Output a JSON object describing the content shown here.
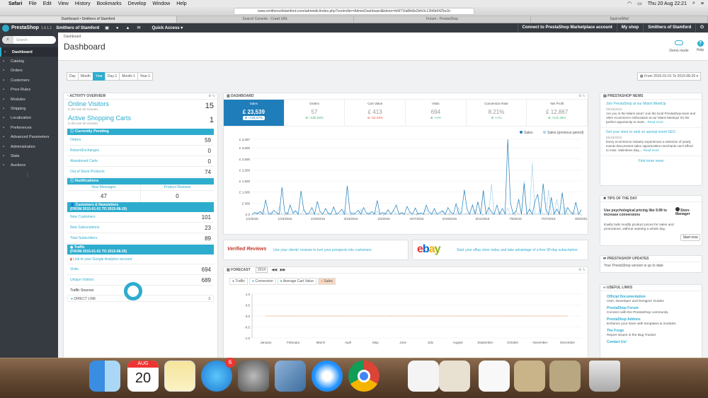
{
  "menubar": {
    "items": [
      "Safari",
      "File",
      "Edit",
      "View",
      "History",
      "Bookmarks",
      "Develop",
      "Window",
      "Help"
    ],
    "datetime": "Thu 20 Aug  22:21"
  },
  "browser": {
    "url": "www.smithersofstamford.com/admindic/index.php?controller=AdminDashboard&token=fe5f71fa8fe8e2bfc0c12b6b6425e1b",
    "tabs": [
      "Dashboard • Smithers of Stamford",
      "Search Console - Crawl URL",
      "Forum - PrestaShop",
      "SquirrelMail"
    ]
  },
  "header": {
    "brand": "PrestaShop",
    "version": "1.6.1.1",
    "shop_name": "Smithers of Stamford",
    "quick_access": "Quick Access ▾",
    "marketplace": "Connect to PrestaShop Marketplace account",
    "my_shop": "My shop",
    "employee": "Smithers of Stamford"
  },
  "sidebar": {
    "search_placeholder": "Search",
    "items": [
      {
        "label": "Dashboard",
        "icon": "dashboard-icon"
      },
      {
        "label": "Catalog",
        "icon": "catalog-icon"
      },
      {
        "label": "Orders",
        "icon": "orders-icon"
      },
      {
        "label": "Customers",
        "icon": "customers-icon"
      },
      {
        "label": "Price Rules",
        "icon": "price-rules-icon"
      },
      {
        "label": "Modules",
        "icon": "modules-icon"
      },
      {
        "label": "Shipping",
        "icon": "shipping-icon"
      },
      {
        "label": "Localization",
        "icon": "localization-icon"
      },
      {
        "label": "Preferences",
        "icon": "preferences-icon"
      },
      {
        "label": "Advanced Parameters",
        "icon": "advanced-parameters-icon"
      },
      {
        "label": "Administration",
        "icon": "administration-icon"
      },
      {
        "label": "Stats",
        "icon": "stats-icon"
      },
      {
        "label": "Auctions",
        "icon": "auctions-icon"
      }
    ]
  },
  "toolbar": {
    "breadcrumb": "Dashboard",
    "title": "Dashboard",
    "demo_mode": "Demo mode",
    "help": "Help"
  },
  "period": {
    "buttons": [
      "Day",
      "Month",
      "Year",
      "Day-1",
      "Month-1",
      "Year-1"
    ],
    "active": "Year",
    "range": "From 2015-01-01 To 2015-08-20 ▾"
  },
  "activity": {
    "title": "Activity overview",
    "online_visitors": {
      "label": "Online Visitors",
      "sub": "in the last 30 minutes",
      "value": "15"
    },
    "active_carts": {
      "label": "Active Shopping Carts",
      "sub": "in the last 30 minutes",
      "value": "1"
    },
    "pending_title": "Currently Pending",
    "pending": [
      {
        "label": "Orders",
        "value": "59"
      },
      {
        "label": "Return/Exchanges",
        "value": "0"
      },
      {
        "label": "Abandoned Carts",
        "value": "0"
      },
      {
        "label": "Out of Stock Products",
        "value": "74"
      }
    ],
    "notifications_title": "Notifications",
    "notifications": [
      {
        "label": "New Messages",
        "value": "47"
      },
      {
        "label": "Product Reviews",
        "value": "0"
      }
    ],
    "customers_title": "Customers & Newsletters",
    "customers_range": "(FROM 2015-01-01 TO 2015-08-20)",
    "customers": [
      {
        "label": "New Customers",
        "value": "101"
      },
      {
        "label": "New Subscriptions",
        "value": "23"
      },
      {
        "label": "Total Subscribers",
        "value": "89"
      }
    ],
    "traffic_title": "Traffic",
    "traffic_range": "(FROM 2015-01-01 TO 2015-08-20)",
    "ga_link": "Link to your Google Analytics account",
    "traffic": [
      {
        "label": "Visits",
        "value": "694"
      },
      {
        "label": "Unique Visitors",
        "value": "689"
      }
    ],
    "traffic_sources_label": "Traffic Sources",
    "source": {
      "label": "DIRECT LINK",
      "value": "3"
    }
  },
  "dashboard": {
    "title": "Dashboard",
    "kpis": [
      {
        "label": "Sales",
        "value": "£ 23,539",
        "delta": "+126.57%",
        "trend": "up"
      },
      {
        "label": "Orders",
        "value": "57",
        "delta": "+235.29%",
        "trend": "up"
      },
      {
        "label": "Cart Value",
        "value": "£ 413",
        "delta": "-32.43%",
        "trend": "down"
      },
      {
        "label": "Visits",
        "value": "694",
        "delta": "+∞%",
        "trend": "up"
      },
      {
        "label": "Conversion Rate",
        "value": "8.21%",
        "delta": "+∞%",
        "trend": "up"
      },
      {
        "label": "Net Profit",
        "value": "£ 12,867",
        "delta": "+121.25%",
        "trend": "up"
      }
    ]
  },
  "chart_data": [
    {
      "type": "line",
      "title": "",
      "legend": [
        "Sales",
        "Sales (previous period)"
      ],
      "legend_position": "top-right",
      "ylabel": "",
      "ylim": [
        0,
        3387
      ],
      "y_ticks": [
        "£ 3,387",
        "£ 3,000",
        "£ 2,500",
        "£ 2,000",
        "£ 1,500",
        "£ 1,000",
        "£ 500",
        "£ 0"
      ],
      "y_tick_values": [
        3387,
        3000,
        2500,
        2000,
        1500,
        1000,
        500,
        0
      ],
      "x_ticks": [
        "1/1/2015",
        "1/23/2015",
        "2/18/2015",
        "3/10/2015",
        "4/2/2015",
        "4/27/2015",
        "5/19/2015",
        "6/11/2015",
        "7/5/2015",
        "7/27/2015",
        "8/20/201"
      ],
      "series": [
        {
          "name": "Sales",
          "color": "#1f7dba",
          "values": [
            0,
            80,
            30,
            120,
            0,
            650,
            40,
            0,
            180,
            60,
            0,
            1220,
            90,
            0,
            420,
            50,
            150,
            0,
            1050,
            200,
            0,
            60,
            300,
            0,
            580,
            120,
            0,
            260,
            40,
            0,
            330,
            0,
            80,
            220,
            0,
            1280,
            90,
            0,
            40,
            180,
            0,
            300,
            60,
            0,
            120,
            0,
            620,
            0,
            80,
            0,
            200,
            0,
            160,
            420,
            0,
            60,
            0,
            350,
            90,
            0,
            280,
            0,
            60,
            0,
            410,
            120,
            0,
            260,
            0,
            80,
            160,
            0,
            300,
            100,
            0,
            480,
            0,
            70,
            1100,
            230,
            0,
            420,
            0,
            560,
            0,
            1060,
            0,
            300,
            90,
            0,
            410,
            0,
            260,
            0,
            3380,
            480,
            0,
            120,
            680,
            0,
            1380,
            0,
            230,
            0,
            580,
            900,
            0,
            1380,
            210,
            0,
            760,
            0,
            230,
            0,
            980,
            0,
            300,
            120,
            0,
            540,
            0,
            200
          ]
        },
        {
          "name": "Sales (previous period)",
          "color": "#a8d4ee",
          "values": [
            0,
            0,
            60,
            0,
            200,
            0,
            0,
            120,
            0,
            0,
            340,
            0,
            0,
            80,
            0,
            0,
            160,
            0,
            0,
            230,
            0,
            0,
            90,
            0,
            0,
            120,
            0,
            0,
            60,
            0,
            0,
            40,
            0,
            0,
            160,
            0,
            0,
            100,
            0,
            0,
            220,
            0,
            0,
            80,
            0,
            0,
            140,
            0,
            0,
            70,
            0,
            0,
            180,
            0,
            0,
            90,
            0,
            0,
            110,
            0,
            0,
            60,
            0,
            0,
            240,
            0,
            0,
            80,
            0,
            0,
            120,
            0,
            0,
            90,
            0,
            0,
            300,
            0,
            0,
            80,
            0,
            0,
            200,
            0,
            0,
            1100,
            0,
            0,
            1380,
            0,
            0,
            120,
            0,
            0,
            280,
            0,
            0,
            160,
            0,
            0,
            1500,
            0,
            0,
            2320,
            0,
            0,
            230,
            0,
            0,
            1100,
            0,
            0,
            680,
            0,
            0,
            300,
            0,
            0,
            120,
            0,
            0,
            180
          ]
        }
      ]
    },
    {
      "type": "line",
      "title": "",
      "legend": [
        "Traffic",
        "Conversion",
        "Average Cart Value",
        "Sales"
      ],
      "legend_position": "top-left",
      "ylim": [
        -1.0,
        1.0
      ],
      "y_ticks": [
        "1.0",
        "0.5",
        "0.0",
        "-0.5",
        "-1.0"
      ],
      "y_tick_values": [
        1.0,
        0.5,
        0.0,
        -0.5,
        -1.0
      ],
      "categories": [
        "January",
        "February",
        "March",
        "April",
        "May",
        "June",
        "July",
        "August",
        "September",
        "October",
        "November",
        "December"
      ],
      "series": [
        {
          "name": "Sales",
          "color": "#f0a16b",
          "values": [
            0,
            0,
            0,
            0,
            0,
            0,
            0,
            0,
            0,
            0,
            0,
            0
          ]
        }
      ]
    }
  ],
  "ads": {
    "verified_reviews_logo": "Verified Reviews",
    "verified_reviews_text": "Use your clients' reviews to turn your prospects into customers",
    "ebay_logo": "ebay",
    "ebay_text": "Start your eBay store today and take advantage of a free 90-day subscription"
  },
  "forecast": {
    "title": "Forecast",
    "year": "2014",
    "legend": [
      {
        "label": "Traffic",
        "color": "#9b59b6"
      },
      {
        "label": "Conversion",
        "color": "#2eacce"
      },
      {
        "label": "Average Cart Value",
        "color": "#1abc9c"
      },
      {
        "label": "Sales",
        "color": "#f0a16b"
      }
    ]
  },
  "news": {
    "title": "PrestaShop News",
    "items": [
      {
        "title": "Join PrestaShop at our Miami MeetUp",
        "date": "08/19/2015",
        "text": "Are you in the Miami area? Join the local PrestaShop team and other ecommerce enthusiasts at our Miami MeetUp! It's the perfect opportunity to meet...",
        "more": "Read more"
      },
      {
        "title": "Get your store to rank on special event SEO",
        "date": "08/18/2015",
        "text": "Every ecommerce industry experiences a selection of yearly events that present sales opportunities merchants can't afford to miss: Valentines Day,...",
        "more": "Read more"
      }
    ],
    "find_more": "Find more news"
  },
  "tips": {
    "title": "Tips of the day",
    "text": "Use psychological pricing like 9.99 to increase conversions",
    "sub": "Easily bulk modify product prices for sales and promotions, without wasting a whole day.",
    "logo": "Store Manager",
    "button": "Start now"
  },
  "updates": {
    "title": "PrestaShop Updates",
    "text": "Your PrestaShop version is up to date"
  },
  "links": {
    "title": "Useful links",
    "items": [
      {
        "title": "Official Documentation",
        "desc": "User, Developer and Designer Guides"
      },
      {
        "title": "PrestaShop Forum",
        "desc": "Connect with the PrestaShop community"
      },
      {
        "title": "PrestaShop Addons",
        "desc": "Enhance your store with templates & modules"
      },
      {
        "title": "The Forge",
        "desc": "Report issues in the Bug Tracker"
      },
      {
        "title": "Contact Us!",
        "desc": ""
      }
    ]
  },
  "dock": {
    "calendar_month": "AUG",
    "calendar_day": "20",
    "appstore_badge": "6",
    "apps": [
      "finder-icon",
      "calendar-icon",
      "notes-icon",
      "app-store-icon",
      "system-preferences-icon",
      "preview-icon",
      "safari-icon",
      "chrome-icon",
      "document-icon",
      "document-icon",
      "document-icon",
      "document-icon",
      "document-icon",
      "trash-icon"
    ]
  }
}
